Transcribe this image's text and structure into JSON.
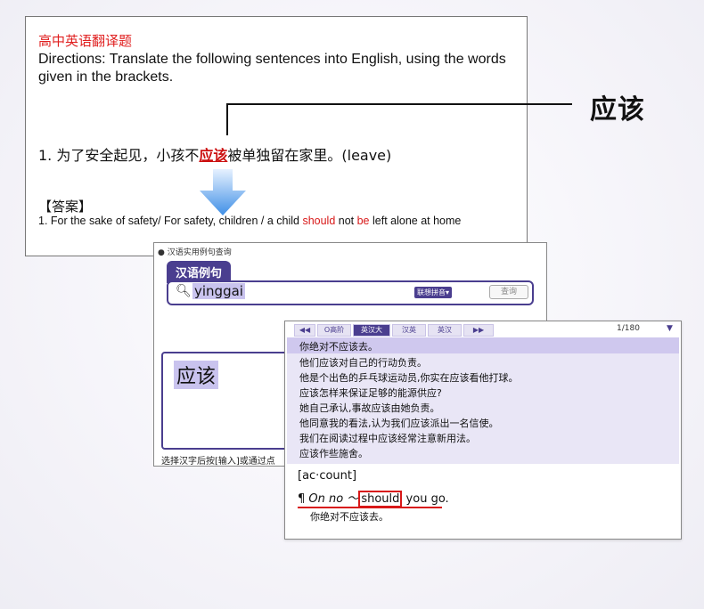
{
  "question": {
    "title": "高中英语翻译题",
    "directions": "Directions: Translate the following sentences into English, using the words given in the brackets.",
    "sentence_before": "1. 为了安全起见，小孩不",
    "sentence_highlight": "应该",
    "sentence_after": "被单独留在家里。(leave)",
    "answer_heading": "【答案】",
    "answer_parts": [
      "1. For the sake of safety/ For safety, children / a child ",
      "should",
      " not ",
      "be",
      " left alone at home"
    ]
  },
  "callout_label": "应该",
  "search_window": {
    "header": "● 汉语实用例句查询",
    "tab": "汉语例句",
    "query": "yinggai",
    "mode_label": "联想拼音▾",
    "search_button": "查询",
    "result_word": "应该",
    "footer": "选择汉字后按[输入]或通过点"
  },
  "result_window": {
    "tabs": [
      "◀◀",
      "O高阶",
      "英汉大",
      "汉英",
      "英汉",
      "▶▶"
    ],
    "active_tab": 2,
    "count": "1/180",
    "sentences": [
      "你绝对不应该去。",
      "他们应该对自己的行动负责。",
      "他是个出色的乒乓球运动员,你实在应该看他打球。",
      "应该怎样来保证足够的能源供应?",
      "她自己承认,事故应该由她负责。",
      "他同意我的看法,认为我们应该派出一名信使。",
      "我们在阅读过程中应该经常注意新用法。",
      "应该作些施舍。"
    ],
    "entry_word": "[ac·count]",
    "example_prefix": "¶ ",
    "example_italic": "On no ～",
    "example_boxed": "should",
    "example_rest": " you go.",
    "translation": "你绝对不应该去。"
  },
  "colors": {
    "accent": "#4a3e8f",
    "highlight_red": "#d81818"
  }
}
